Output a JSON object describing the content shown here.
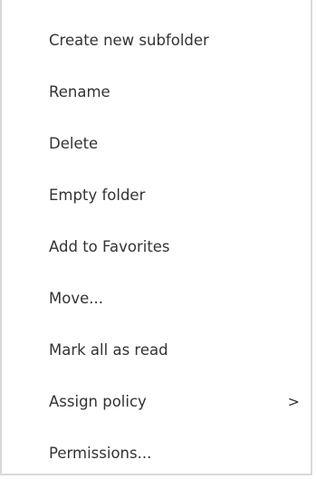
{
  "menu": {
    "items": [
      {
        "label": "Create new subfolder"
      },
      {
        "label": "Rename"
      },
      {
        "label": "Delete"
      },
      {
        "label": "Empty folder"
      },
      {
        "label": "Add to Favorites"
      },
      {
        "label": "Move..."
      },
      {
        "label": "Mark all as read"
      },
      {
        "label": "Assign policy",
        "submenu_indicator": ">"
      },
      {
        "label": "Permissions..."
      }
    ]
  }
}
